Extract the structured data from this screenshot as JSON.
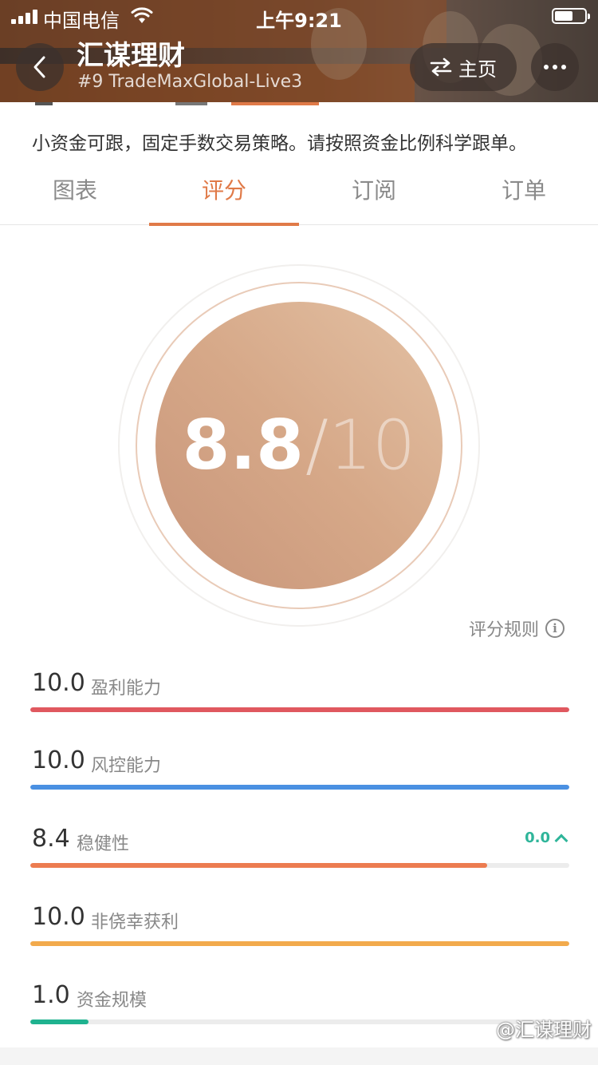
{
  "status_bar": {
    "carrier": "中国电信",
    "time": "上午9:21"
  },
  "header": {
    "title": "汇谋理财",
    "subtitle": "#9 TradeMaxGlobal-Live3",
    "home_label": "主页",
    "back_icon": "back-arrow-icon",
    "home_icon": "swap-arrows-icon",
    "more_icon": "more-dots-icon"
  },
  "description": "小资金可跟，固定手数交易策略。请按照资金比例科学跟单。",
  "tabs": [
    {
      "label": "图表"
    },
    {
      "label": "评分",
      "active": true
    },
    {
      "label": "订阅"
    },
    {
      "label": "订单"
    }
  ],
  "score": {
    "value": "8.8",
    "separator": "/",
    "max": "10"
  },
  "rules_link": "评分规则",
  "metrics": [
    {
      "value": "10.0",
      "label": "盈利能力",
      "fraction": 1.0,
      "color": "#e0585f"
    },
    {
      "value": "10.0",
      "label": "风控能力",
      "fraction": 1.0,
      "color": "#4a90e2"
    },
    {
      "value": "8.4",
      "label": "稳健性",
      "fraction": 0.848,
      "color": "#ec7c50",
      "change": "0.0"
    },
    {
      "value": "10.0",
      "label": "非侥幸获利",
      "fraction": 1.0,
      "color": "#f2aa4c"
    },
    {
      "value": "1.0",
      "label": "资金规模",
      "fraction": 0.108,
      "color": "#1fb28f"
    }
  ],
  "colors": {
    "accent": "#e07a48",
    "positive": "#2fb59a"
  },
  "watermark": "@汇谋理财"
}
